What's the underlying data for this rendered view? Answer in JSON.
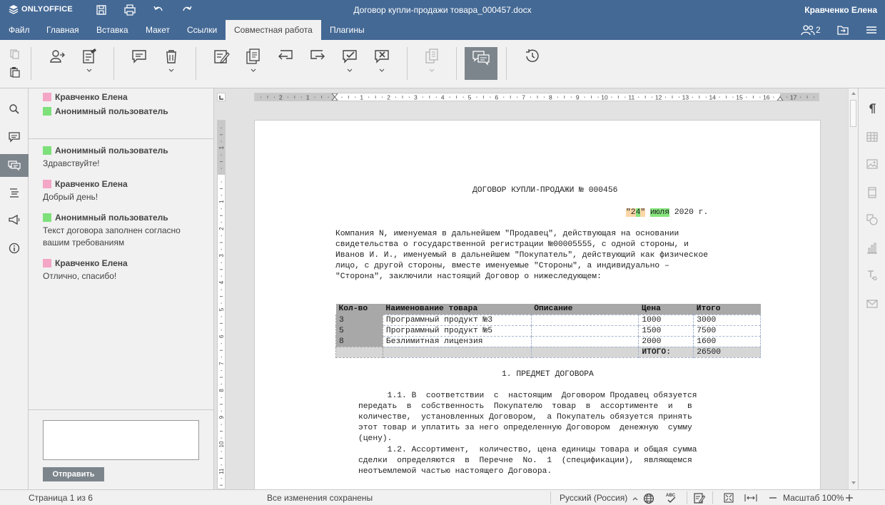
{
  "app": {
    "brand": "ONLYOFFICE",
    "document_title": "Договор купли-продажи товара_000457.docx",
    "current_user": "Кравченко Елена",
    "users_count": "2"
  },
  "menu": {
    "tabs": [
      {
        "label": "Файл"
      },
      {
        "label": "Главная"
      },
      {
        "label": "Вставка"
      },
      {
        "label": "Макет"
      },
      {
        "label": "Ссылки"
      },
      {
        "label": "Совместная работа"
      },
      {
        "label": "Плагины"
      }
    ],
    "active_tab": "Совместная работа"
  },
  "chat": {
    "participants": [
      {
        "name": "Кравченко Елена",
        "color": "#f4a6c6"
      },
      {
        "name": "Анонимный пользователь",
        "color": "#7de07a"
      }
    ],
    "messages": [
      {
        "author": "Анонимный пользователь",
        "color": "#7de07a",
        "text": "Здравствуйте!"
      },
      {
        "author": "Кравченко Елена",
        "color": "#f4a6c6",
        "text": "Добрый день!"
      },
      {
        "author": "Анонимный пользователь",
        "color": "#7de07a",
        "text": "Текст договора заполнен согласно вашим требованиям"
      },
      {
        "author": "Кравченко Елена",
        "color": "#f4a6c6",
        "text": "Отлично, спасибо!"
      }
    ],
    "input_value": "",
    "send_label": "Отправить"
  },
  "document": {
    "heading": "ДОГОВОР КУПЛИ-ПРОДАЖИ № 000456",
    "date": {
      "quote_open": "\"",
      "day_a": "2",
      "day_b": "4",
      "quote_close": "\"",
      "month": "июля",
      "year": "2020 г."
    },
    "intro_lines": [
      "Компания N, именуемая в дальнейшем \"Продавец\", действующая на основании",
      "свидетельства о государственной регистрации №00005555, с одной стороны, и",
      "Иванов И. И., именуемый в дальнейшем \"Покупатель\", действующий как физическое",
      "лицо, с другой стороны, вместе именуемые \"Стороны\", а индивидуально –",
      "\"Сторона\", заключили настоящий Договор о нижеследующем:"
    ],
    "table": {
      "headers": [
        "Кол-во",
        "Наименование товара",
        "Описание",
        "Цена",
        "Итого"
      ],
      "rows": [
        [
          "3",
          "Программный продукт №3",
          "",
          "1000",
          "3000"
        ],
        [
          "5",
          "Программный продукт №5",
          "",
          "1500",
          "7500"
        ],
        [
          "8",
          "Безлимитная лицензия",
          "",
          "2000",
          "1600"
        ]
      ],
      "total_label": "ИТОГО:",
      "total_value": "26500"
    },
    "section_title": "1. ПРЕДМЕТ ДОГОВОРА",
    "section_lines": [
      "      1.1. В  соответствии  с  настоящим  Договором Продавец обязуется",
      "передать  в  собственность  Покупателю  товар  в  ассортименте  и   в",
      "количестве,  установленных Договором,  а Покупатель обязуется принять",
      "этот товар и уплатить за него определенную Договором  денежную  сумму",
      "(цену).",
      "      1.2. Ассортимент,  количество, цена единицы товара и общая сумма",
      "сделки  определяются  в  Перечне  No.  1  (спецификации),  являющемся",
      "неотъемлемой частью настоящего Договора."
    ]
  },
  "ruler": {
    "h_labels": [
      "2",
      "1",
      "1",
      "2",
      "3",
      "4",
      "5",
      "6",
      "7",
      "8",
      "9",
      "10",
      "11",
      "12",
      "13",
      "14",
      "15",
      "16",
      "17"
    ],
    "v_labels": [
      "1",
      "1",
      "2",
      "3",
      "4",
      "5",
      "6",
      "7",
      "8",
      "9",
      "10",
      "11"
    ]
  },
  "statusbar": {
    "page_info": "Страница 1 из 6",
    "save_status": "Все изменения сохранены",
    "language": "Русский (Россия)",
    "zoom": "Масштаб 100%"
  },
  "colors": {
    "header_bg": "#446995",
    "toolbar_bg": "#f1f1f1",
    "active_button": "#7d858c"
  }
}
